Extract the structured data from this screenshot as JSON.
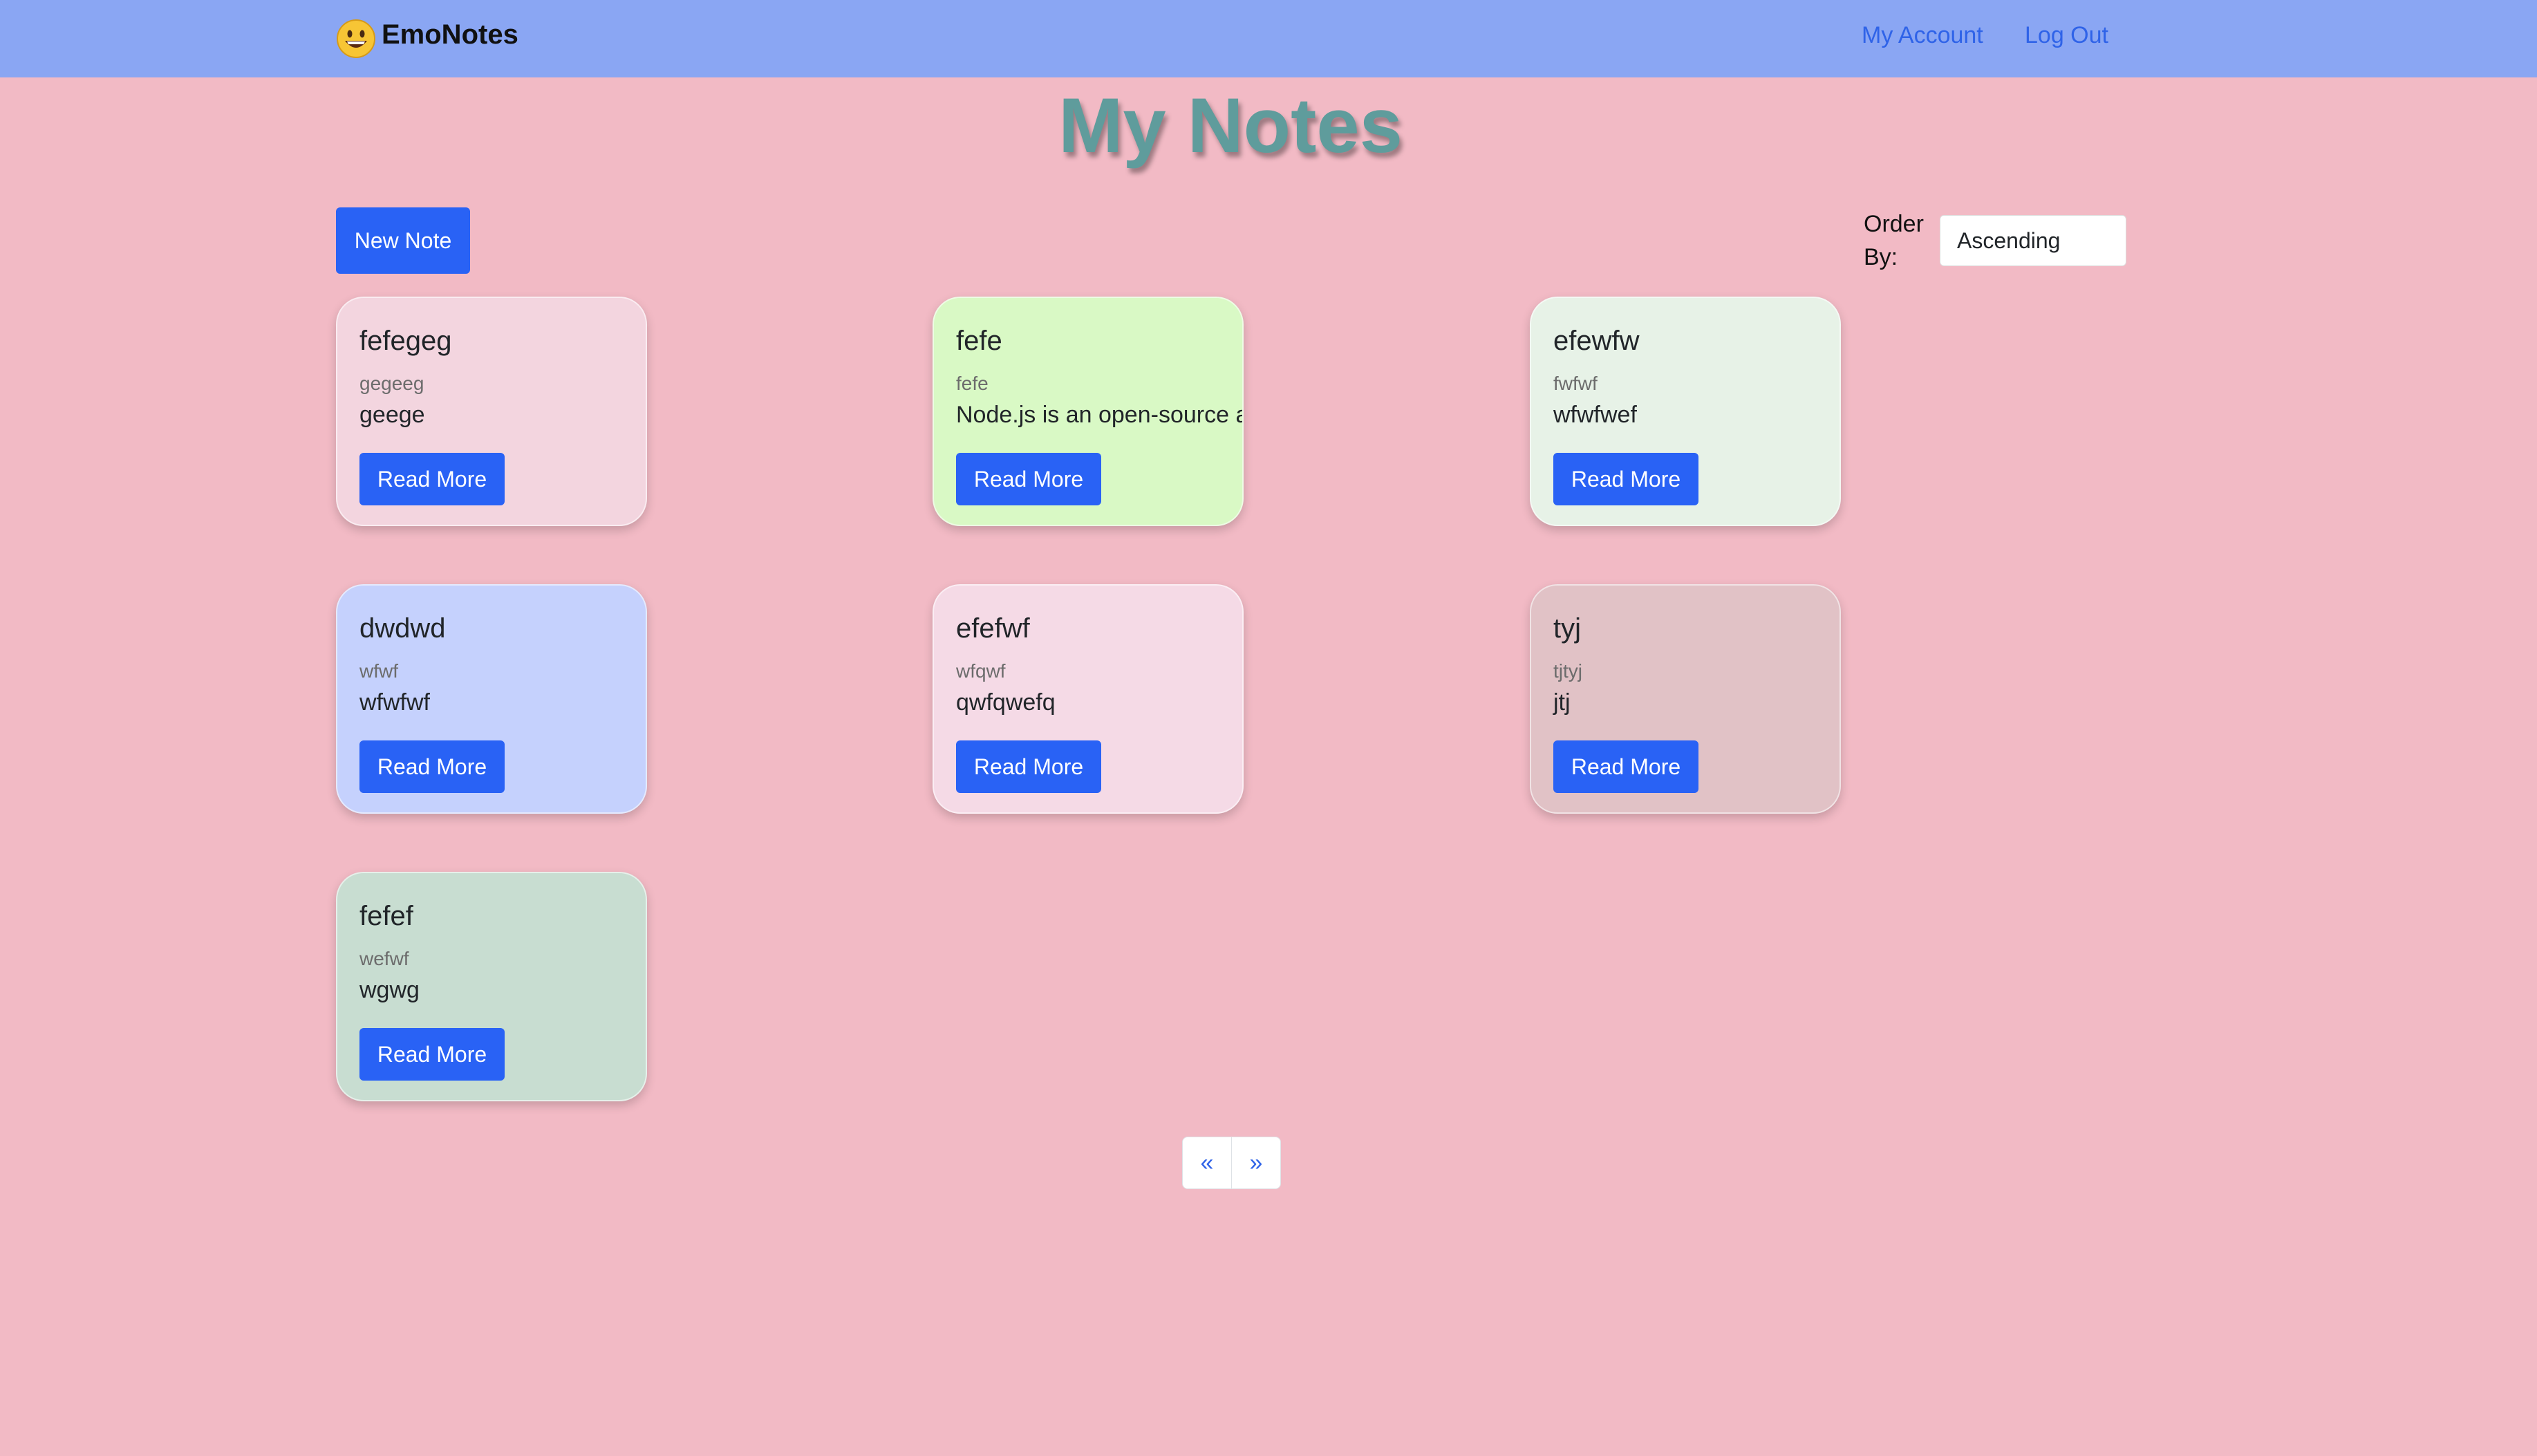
{
  "navbar": {
    "brand_name": "EmoNotes",
    "brand_icon": "grinning-face-emoji",
    "links": {
      "account": "My Account",
      "logout": "Log Out"
    }
  },
  "page_title": "My Notes",
  "toolbar": {
    "new_note_label": "New Note",
    "order_label": "Order By:",
    "order_value": "Ascending"
  },
  "notes": [
    {
      "title": "fefegeg",
      "subtitle": "gegeeg",
      "text": "geege",
      "button": "Read More",
      "color": "#f3d5df"
    },
    {
      "title": "fefe",
      "subtitle": "fefe",
      "text": "Node.js is an open-source ar",
      "button": "Read More",
      "color": "#d9f9c5"
    },
    {
      "title": "efewfw",
      "subtitle": "fwfwf",
      "text": "wfwfwef",
      "button": "Read More",
      "color": "#e7f2e7"
    },
    {
      "title": "dwdwd",
      "subtitle": "wfwf",
      "text": "wfwfwf",
      "button": "Read More",
      "color": "#c5d1fd"
    },
    {
      "title": "efefwf",
      "subtitle": "wfqwf",
      "text": "qwfqwefq",
      "button": "Read More",
      "color": "#f5dae6"
    },
    {
      "title": "tyj",
      "subtitle": "tjtyj",
      "text": "jtj",
      "button": "Read More",
      "color": "#e1c2c6"
    },
    {
      "title": "fefef",
      "subtitle": "wefwf",
      "text": "wgwg",
      "button": "Read More",
      "color": "#c8ddd1"
    }
  ],
  "pagination": {
    "prev": "«",
    "next": "»"
  },
  "colors": {
    "page_background": "#f2bac5",
    "navbar": "#8aa6f3",
    "primary_button": "#2962f5",
    "link": "#2f63e8",
    "title": "#5f9c9c"
  }
}
